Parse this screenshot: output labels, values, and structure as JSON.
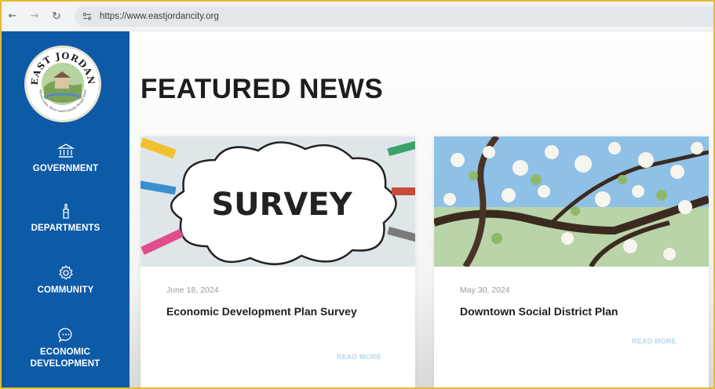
{
  "browser": {
    "url": "https://www.eastjordancity.org",
    "back_icon": "arrow-left-icon",
    "forward_icon": "arrow-right-icon",
    "reload_icon": "reload-icon",
    "site_info_icon": "tune-icon"
  },
  "sidebar": {
    "bg_color": "#0d5aa7",
    "logo": {
      "text": "EAST JORDAN",
      "tagline": "Where Lake, River and Friendly People Meet"
    },
    "items": [
      {
        "label": "GOVERNMENT",
        "icon": "bank-icon"
      },
      {
        "label": "DEPARTMENTS",
        "icon": "hand-icon"
      },
      {
        "label": "COMMUNITY",
        "icon": "gear-icon"
      },
      {
        "label": "ECONOMIC DEVELOPMENT",
        "icon": "chat-icon"
      }
    ]
  },
  "main": {
    "title": "FEATURED NEWS",
    "cards": [
      {
        "image_text": "SURVEY",
        "date": "June 18, 2024",
        "title": "Economic Development Plan Survey",
        "read_more": "READ MORE"
      },
      {
        "date": "May 30, 2024",
        "title": "Downtown Social District Plan",
        "read_more": "READ MORE"
      }
    ]
  },
  "colors": {
    "accent": "#0d5aa7",
    "frame": "#e7b92f",
    "read_more": "#b9d6ea"
  }
}
